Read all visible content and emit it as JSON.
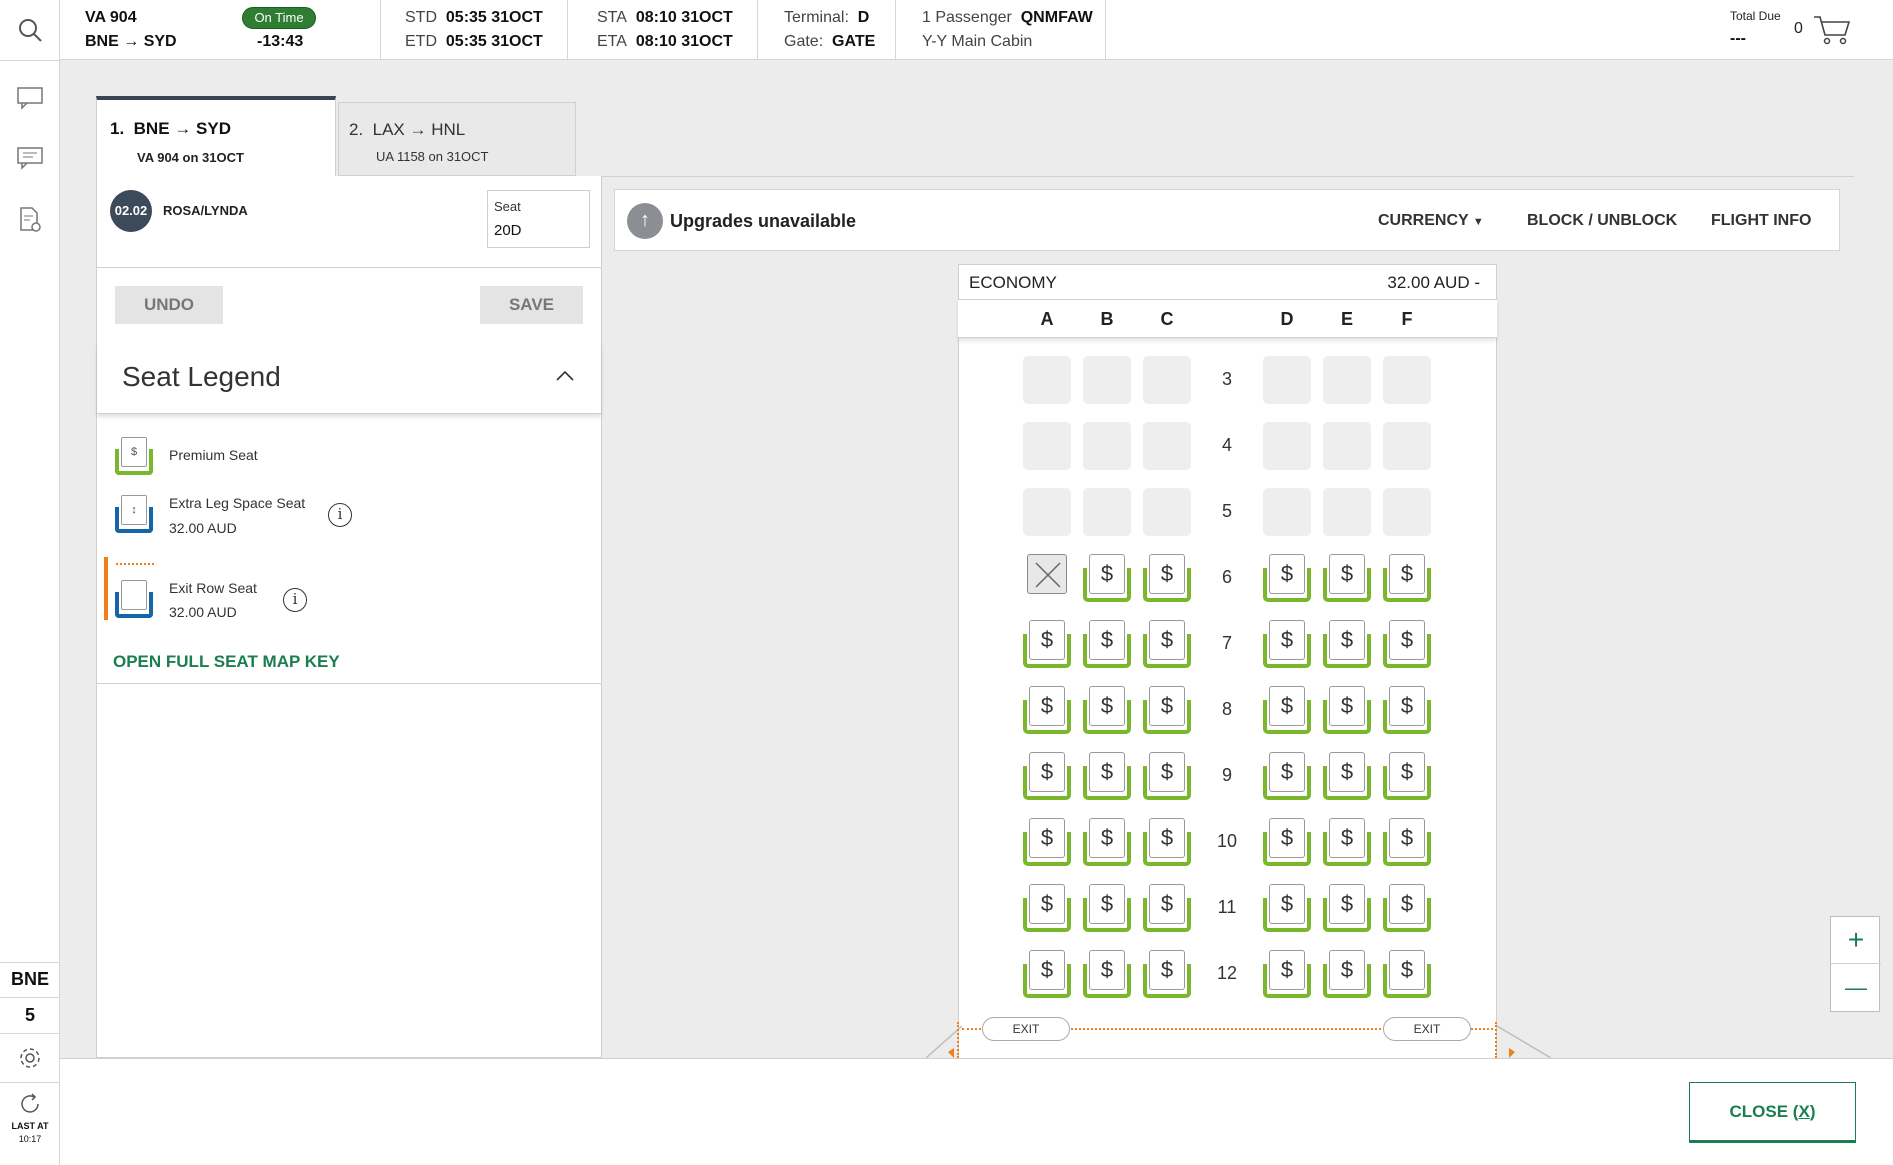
{
  "rail": {
    "station": "BNE",
    "count": "5",
    "last_at_label": "LAST AT",
    "last_at_time": "10:17"
  },
  "header": {
    "flight_number": "VA 904",
    "route_from": "BNE",
    "route_to": "SYD",
    "status_badge": "On Time",
    "countdown": "-13:43",
    "std_label": "STD",
    "std_value": "05:35 31OCT",
    "etd_label": "ETD",
    "etd_value": "05:35 31OCT",
    "sta_label": "STA",
    "sta_value": "08:10 31OCT",
    "eta_label": "ETA",
    "eta_value": "08:10 31OCT",
    "terminal_label": "Terminal:",
    "terminal_value": "D",
    "gate_label": "Gate:",
    "gate_value": "GATE",
    "passengers": "1 Passenger",
    "pnr": "QNMFAW",
    "cabin": "Y-Y Main Cabin",
    "total_due_label": "Total Due",
    "total_due_value": "---",
    "cart_count": "0"
  },
  "tabs": [
    {
      "num": "1.",
      "from": "BNE",
      "to": "SYD",
      "sub": "VA 904 on 31OCT"
    },
    {
      "num": "2.",
      "from": "LAX",
      "to": "HNL",
      "sub": "UA 1158 on 31OCT"
    }
  ],
  "passenger": {
    "badge": "02.02",
    "name": "ROSA/LYNDA",
    "seat_label": "Seat",
    "seat_value": "20D"
  },
  "actions": {
    "undo": "UNDO",
    "save": "SAVE"
  },
  "legend": {
    "title": "Seat Legend",
    "premium_label": "Premium Seat",
    "extra_leg_label": "Extra Leg Space Seat",
    "extra_leg_price": "32.00 AUD",
    "exit_row_label": "Exit Row Seat",
    "exit_row_price": "32.00 AUD",
    "open_key": "OPEN FULL SEAT MAP KEY"
  },
  "upgrades": {
    "text": "Upgrades unavailable",
    "currency": "CURRENCY",
    "block_unblock": "BLOCK / UNBLOCK",
    "flight_info": "FLIGHT INFO"
  },
  "seatmap": {
    "cabin_name": "ECONOMY",
    "cabin_price": "32.00 AUD -",
    "columns": [
      "A",
      "B",
      "C",
      "D",
      "E",
      "F"
    ],
    "rows": [
      {
        "row": "3",
        "seats": [
          "blocked",
          "blocked",
          "blocked",
          "blocked",
          "blocked",
          "blocked"
        ]
      },
      {
        "row": "4",
        "seats": [
          "blocked",
          "blocked",
          "blocked",
          "blocked",
          "blocked",
          "blocked"
        ]
      },
      {
        "row": "5",
        "seats": [
          "blocked",
          "blocked",
          "blocked",
          "blocked",
          "blocked",
          "blocked"
        ]
      },
      {
        "row": "6",
        "seats": [
          "taken",
          "premium",
          "premium",
          "premium",
          "premium",
          "premium"
        ]
      },
      {
        "row": "7",
        "seats": [
          "premium",
          "premium",
          "premium",
          "premium",
          "premium",
          "premium"
        ]
      },
      {
        "row": "8",
        "seats": [
          "premium",
          "premium",
          "premium",
          "premium",
          "premium",
          "premium"
        ]
      },
      {
        "row": "9",
        "seats": [
          "premium",
          "premium",
          "premium",
          "premium",
          "premium",
          "premium"
        ]
      },
      {
        "row": "10",
        "seats": [
          "premium",
          "premium",
          "premium",
          "premium",
          "premium",
          "premium"
        ]
      },
      {
        "row": "11",
        "seats": [
          "premium",
          "premium",
          "premium",
          "premium",
          "premium",
          "premium"
        ]
      },
      {
        "row": "12",
        "seats": [
          "premium",
          "premium",
          "premium",
          "premium",
          "premium",
          "premium"
        ]
      }
    ],
    "seat_symbol": "$",
    "exit_left": "EXIT",
    "exit_right": "EXIT"
  },
  "zoom": {
    "in": "+",
    "out": "—"
  },
  "footer": {
    "close": "CLOSE",
    "close_key": "X"
  },
  "colors": {
    "accent": "#1a7e52",
    "premium": "#7ab72c",
    "exit": "#f07e1a",
    "extra_leg": "#1565a8"
  }
}
